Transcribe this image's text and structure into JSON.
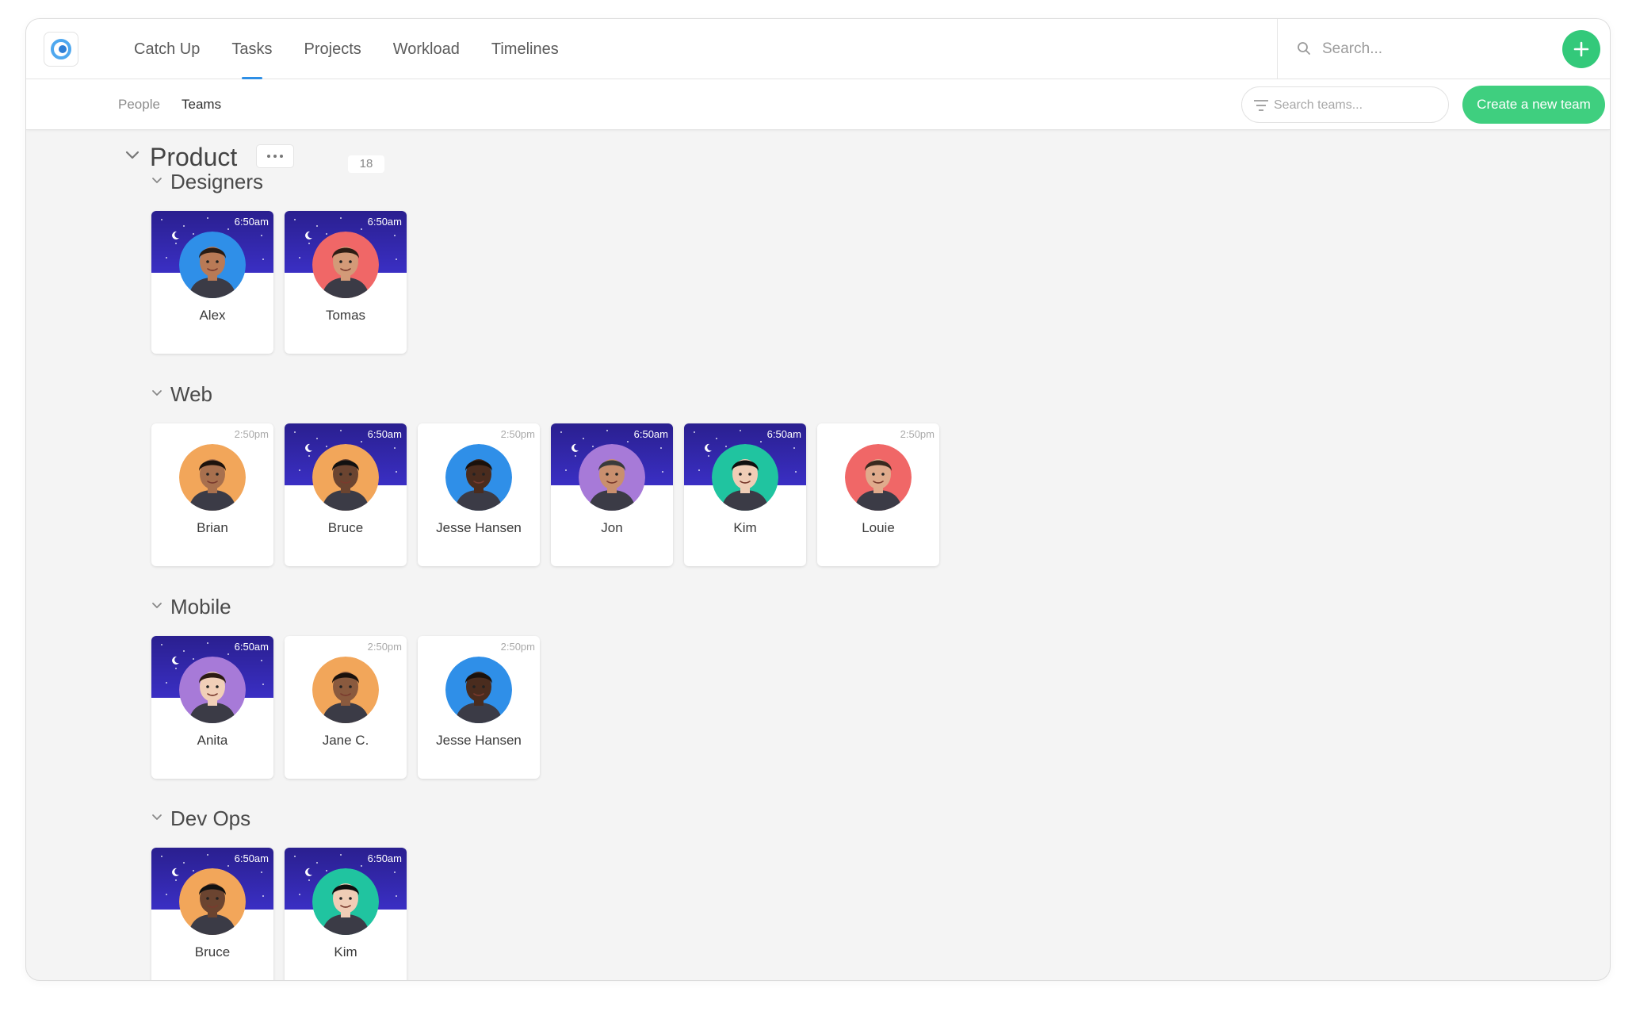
{
  "nav": {
    "items": [
      "Catch Up",
      "Tasks",
      "Projects",
      "Workload",
      "Timelines"
    ],
    "active": "Tasks"
  },
  "search": {
    "placeholder": "Search..."
  },
  "subnav": {
    "people": "People",
    "teams": "Teams"
  },
  "teams_search": {
    "placeholder": "Search teams..."
  },
  "create_team_label": "Create a new team",
  "group": {
    "name": "Product",
    "count": "18"
  },
  "teams": [
    {
      "name": "Designers",
      "members": [
        {
          "name": "Alex",
          "time": "6:50am",
          "night": true,
          "ring": "#2f8fe8",
          "skin": "#b97a56",
          "hair": "#2a1c14"
        },
        {
          "name": "Tomas",
          "time": "6:50am",
          "night": true,
          "ring": "#f06767",
          "skin": "#d39a78",
          "hair": "#2d1d14"
        }
      ]
    },
    {
      "name": "Web",
      "members": [
        {
          "name": "Brian",
          "time": "2:50pm",
          "night": false,
          "ring": "#f2a65a",
          "skin": "#a8704e",
          "hair": "#1d130d"
        },
        {
          "name": "Bruce",
          "time": "6:50am",
          "night": true,
          "ring": "#f2a65a",
          "skin": "#6b4430",
          "hair": "#111111"
        },
        {
          "name": "Jesse Hansen",
          "time": "2:50pm",
          "night": false,
          "ring": "#2f8fe8",
          "skin": "#4a2c1e",
          "hair": "#1a110c"
        },
        {
          "name": "Jon",
          "time": "6:50am",
          "night": true,
          "ring": "#a77ad8",
          "skin": "#c98f6e",
          "hair": "#3b3b3b"
        },
        {
          "name": "Kim",
          "time": "6:50am",
          "night": true,
          "ring": "#20c4a0",
          "skin": "#efcdb6",
          "hair": "#0f0f0f"
        },
        {
          "name": "Louie",
          "time": "2:50pm",
          "night": false,
          "ring": "#f06767",
          "skin": "#e0ab8c",
          "hair": "#3a2a1f"
        }
      ]
    },
    {
      "name": "Mobile",
      "members": [
        {
          "name": "Anita",
          "time": "6:50am",
          "night": true,
          "ring": "#a77ad8",
          "skin": "#f1cfb8",
          "hair": "#2b1a12"
        },
        {
          "name": "Jane C.",
          "time": "2:50pm",
          "night": false,
          "ring": "#f2a65a",
          "skin": "#8a5a3e",
          "hair": "#1a110c"
        },
        {
          "name": "Jesse Hansen",
          "time": "2:50pm",
          "night": false,
          "ring": "#2f8fe8",
          "skin": "#4a2c1e",
          "hair": "#1a110c"
        }
      ]
    },
    {
      "name": "Dev Ops",
      "members": [
        {
          "name": "Bruce",
          "time": "6:50am",
          "night": true,
          "ring": "#f2a65a",
          "skin": "#6b4430",
          "hair": "#111111"
        },
        {
          "name": "Kim",
          "time": "6:50am",
          "night": true,
          "ring": "#20c4a0",
          "skin": "#efcdb6",
          "hair": "#0f0f0f"
        }
      ]
    }
  ],
  "icons": {
    "logo": "app-logo-icon",
    "search": "search-icon",
    "add": "plus-icon",
    "filter": "filter-icon",
    "collapse": "chevron-down-icon",
    "more": "more-dots-icon",
    "moon": "moon-icon"
  },
  "colors": {
    "accent_green": "#33c97a",
    "accent_blue": "#2e8fe6",
    "night_band": "#2a1f8f"
  }
}
